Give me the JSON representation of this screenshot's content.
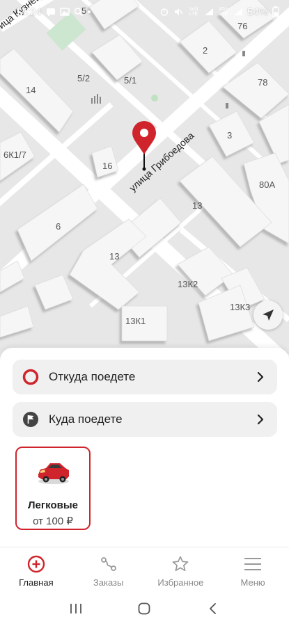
{
  "status_bar": {
    "time": "14:24",
    "battery_percent": "54%",
    "network_labels": [
      "Vo)) LTE",
      "4G+ LTE"
    ]
  },
  "map": {
    "street_name": "улица Грибоедова",
    "corner_street": "ица Кузнец",
    "building_labels": [
      "5",
      "76",
      "2",
      "5/2",
      "5/1",
      "14",
      "78",
      "3",
      "6К1/7",
      "16",
      "80А",
      "13",
      "6",
      "13",
      "13К2",
      "13К3",
      "13К1"
    ]
  },
  "route": {
    "from_label": "Откуда поедете",
    "to_label": "Куда поедете"
  },
  "tariffs": [
    {
      "name": "Легковые",
      "price": "от 100 ₽",
      "selected": true
    }
  ],
  "tabs": [
    {
      "label": "Главная",
      "icon": "plus-circle-icon",
      "active": true
    },
    {
      "label": "Заказы",
      "icon": "route-icon",
      "active": false
    },
    {
      "label": "Избранное",
      "icon": "star-icon",
      "active": false
    },
    {
      "label": "Меню",
      "icon": "menu-icon",
      "active": false
    }
  ],
  "colors": {
    "accent": "#d0242c",
    "map_background": "#e9e9e9",
    "building": "#f4f4f4"
  }
}
